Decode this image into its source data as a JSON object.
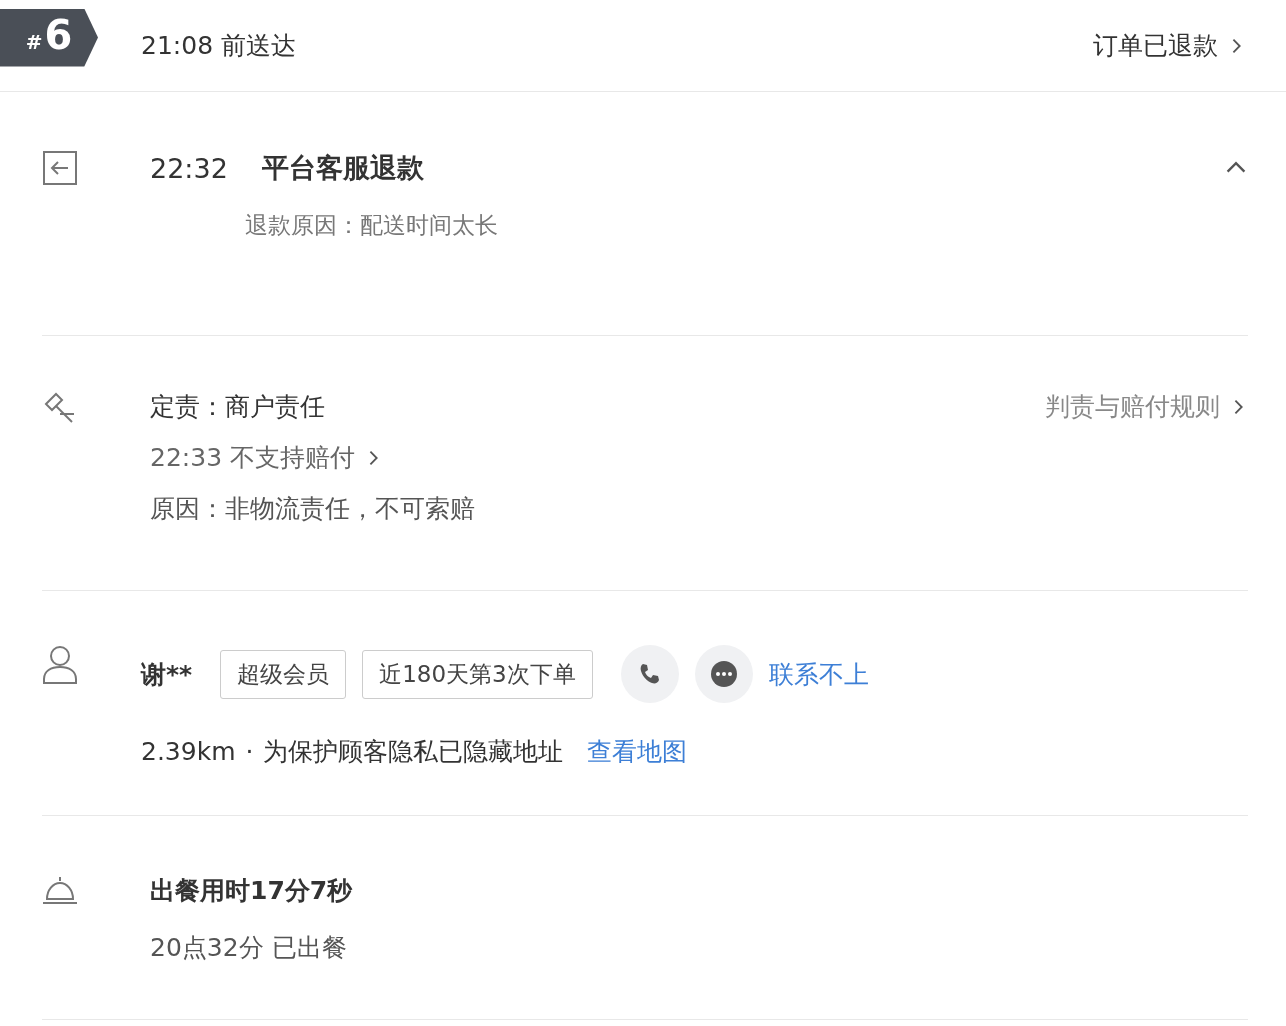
{
  "header": {
    "badge_prefix": "#",
    "badge_number": "6",
    "delivery": "21:08 前送达",
    "status": "订单已退款"
  },
  "refund": {
    "time": "22:32",
    "title": "平台客服退款",
    "reason": "退款原因：配送时间太长",
    "expanded": true
  },
  "liability": {
    "verdict": "定责：商户责任",
    "rules_link": "判责与赔付规则",
    "compensation": "22:33 不支持赔付",
    "reason": "原因：非物流责任，不可索赔"
  },
  "customer": {
    "name": "谢**",
    "tags": [
      "超级会员",
      "近180天第3次下单"
    ],
    "contact_status": "联系不上",
    "distance": "2.39km",
    "separator": "·",
    "privacy_note": "为保护顾客隐私已隐藏地址",
    "map_link": "查看地图"
  },
  "meal": {
    "title": "出餐用时17分7秒",
    "ready": "20点32分 已出餐"
  }
}
